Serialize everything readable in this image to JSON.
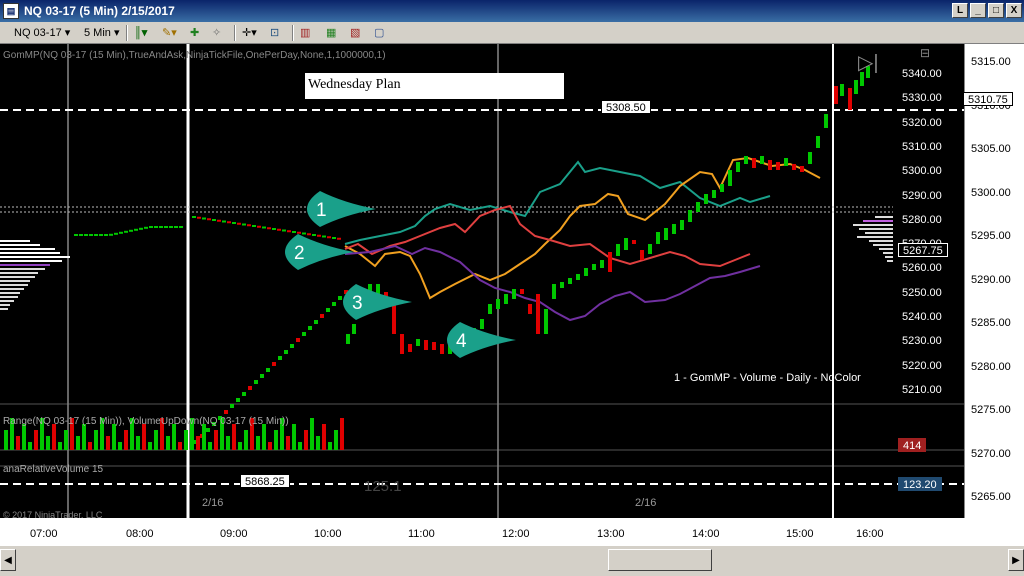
{
  "window": {
    "title": "NQ 03-17 (5 Min)  2/15/2017",
    "icon": "chart-window-icon",
    "buttons": {
      "restore_small": "L",
      "minimize": "_",
      "maximize": "□",
      "close": "X"
    }
  },
  "toolbar": {
    "instrument": "NQ 03-17",
    "interval": "5 Min",
    "icons": [
      "bar-type-icon",
      "pencil-draw-icon",
      "add-indicator-icon",
      "strategy-icon",
      "crosshair-icon",
      "zoom-icon",
      "data-box-icon",
      "chart-properties-icon",
      "template-icon"
    ]
  },
  "chart": {
    "plan_text": "Wednesday Plan",
    "indicator_header": "GomMP(NQ 03-17 (15 Min),TrueAndAsk,NinjaTickFile,OnePerDay,None,1,1000000,1)",
    "volume_header": "Range(NQ 03-17 (15 Min)), VolumeUpDown(NQ 03-17 (15 Min))",
    "rel_vol_header": "anaRelativeVolume 15",
    "legend_text": "1 - GomMP - Volume - Daily - NoColor",
    "copyright": "© 2017 NinjaTrader, LLC",
    "price_level_label": "5308.50",
    "lower_level_label": "5868.25",
    "watermark_left": "2/16",
    "watermark_right": "2/16",
    "faint_value": "125.1",
    "callouts": [
      "1",
      "2",
      "3",
      "4"
    ],
    "colors": {
      "up": "#00c800",
      "down": "#e00000",
      "teal": "#1aa08a",
      "orange": "#f0a020",
      "red": "#e04040",
      "purple": "#7030a0",
      "callout": "#1aa08a"
    }
  },
  "right_axis": {
    "ticks_outer": [
      "5315.00",
      "5310.00",
      "5305.00",
      "5300.00",
      "5295.00",
      "5290.00",
      "5285.00",
      "5280.00",
      "5275.00",
      "5270.00",
      "5265.00"
    ],
    "ticks_inner": [
      "5340.00",
      "5330.00",
      "5320.00",
      "5310.00",
      "5300.00",
      "5290.00",
      "5280.00",
      "5270.00",
      "5260.00",
      "5250.00",
      "5240.00",
      "5230.00",
      "5220.00",
      "5210.00"
    ],
    "last_price": "5310.75",
    "profile_price": "5267.75",
    "badge_414": "414",
    "badge_blue": "123.20"
  },
  "x_axis": {
    "times": [
      "07:00",
      "08:00",
      "09:00",
      "10:00",
      "11:00",
      "12:00",
      "13:00",
      "14:00",
      "15:00",
      "16:00"
    ]
  }
}
